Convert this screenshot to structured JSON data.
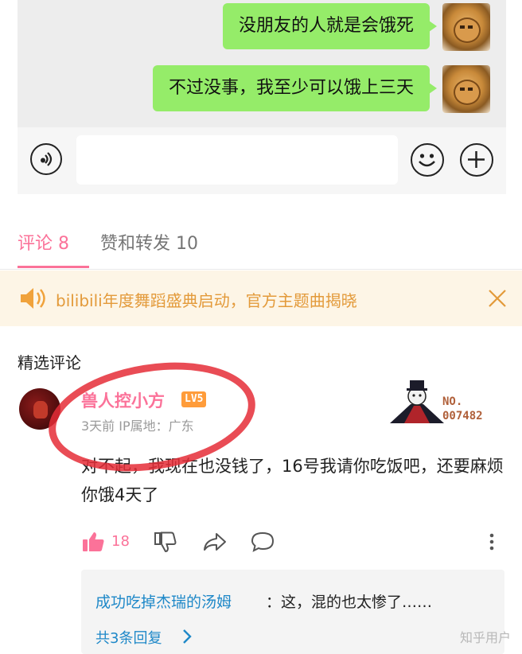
{
  "chat": {
    "messages": [
      {
        "text": "没朋友的人就是会饿死"
      },
      {
        "text": "不过没事，我至少可以饿上三天"
      }
    ]
  },
  "input_bar": {
    "voice_icon": "voice-icon",
    "emoji_icon": "emoji-icon",
    "plus_icon": "plus-icon"
  },
  "tabs": [
    {
      "label": "评论 8",
      "active": true
    },
    {
      "label": "赞和转发 10",
      "active": false
    }
  ],
  "notice": {
    "text": "bilibili年度舞蹈盛典启动，官方主题曲揭晓",
    "color": "#e39a3a"
  },
  "comments_section": {
    "title": "精选评论"
  },
  "comment": {
    "username": "兽人控小方",
    "level": "LV5",
    "meta": "3天前  IP属地：广东",
    "decoration_number": "NO.\n007482",
    "body": "对不起，我现在也没钱了，16号我请你吃饭吧，还要麻烦你饿4天了",
    "like_count": "18"
  },
  "reply": {
    "user": "成功吃掉杰瑞的汤姆",
    "text": "：这，混的也太惨了……",
    "more": "共3条回复"
  },
  "watermark": "知乎用户",
  "colors": {
    "accent_pink": "#fb7299",
    "bubble_green": "#95ec69",
    "link_blue": "#1e88c8",
    "annotation_red": "#e52d37"
  }
}
